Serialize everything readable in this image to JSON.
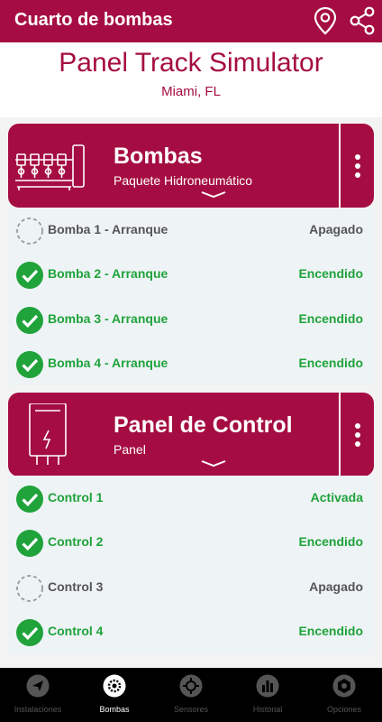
{
  "topbar": {
    "title": "Cuarto de bombas",
    "location_icon": "location-pin-icon",
    "share_icon": "share-icon"
  },
  "header": {
    "title": "Panel Track Simulator",
    "location": "Miami, FL"
  },
  "sections": [
    {
      "title": "Bombas",
      "subtitle": "Paquete Hidroneumático",
      "icon": "pump-package-icon",
      "items": [
        {
          "label": "Bomba 1 - Arranque",
          "state": "Apagado",
          "status": "off"
        },
        {
          "label": "Bomba 2 - Arranque",
          "state": "Encendido",
          "status": "on"
        },
        {
          "label": "Bomba 3 - Arranque",
          "state": "Encendido",
          "status": "on"
        },
        {
          "label": "Bomba 4 - Arranque",
          "state": "Encendido",
          "status": "on"
        }
      ]
    },
    {
      "title": "Panel de Control",
      "subtitle": "Panel",
      "icon": "electrical-panel-icon",
      "items": [
        {
          "label": "Control 1",
          "state": "Activada",
          "status": "on"
        },
        {
          "label": "Control 2",
          "state": "Encendido",
          "status": "on"
        },
        {
          "label": "Control 3",
          "state": "Apagado",
          "status": "off"
        },
        {
          "label": "Control 4",
          "state": "Encendido",
          "status": "on"
        }
      ]
    }
  ],
  "nav": [
    {
      "label": "Instalaciones",
      "icon": "paper-plane-icon",
      "active": false
    },
    {
      "label": "Bombas",
      "icon": "pump-gear-icon",
      "active": true
    },
    {
      "label": "Sensores",
      "icon": "sensor-icon",
      "active": false
    },
    {
      "label": "Historial",
      "icon": "bar-chart-icon",
      "active": false
    },
    {
      "label": "Opciones",
      "icon": "settings-icon",
      "active": false
    }
  ],
  "colors": {
    "brand": "#a50d42",
    "on": "#1fa33a",
    "off": "#555555",
    "list_bg": "#eef3f6"
  }
}
